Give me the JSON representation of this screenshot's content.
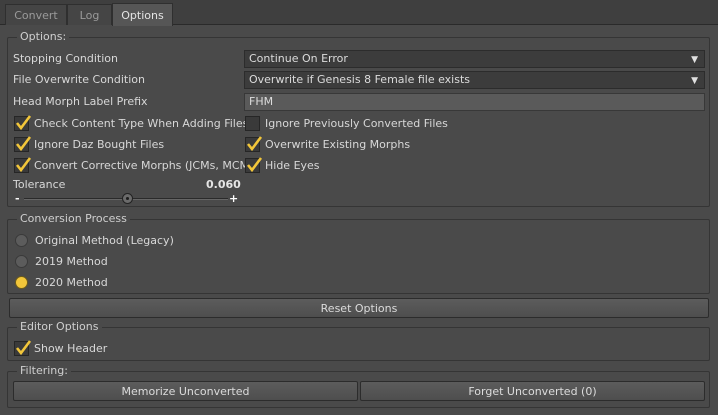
{
  "tabs": [
    {
      "label": "Convert"
    },
    {
      "label": "Log"
    },
    {
      "label": "Options"
    }
  ],
  "options": {
    "group_title": "Options:",
    "stopping_condition": {
      "label": "Stopping Condition",
      "value": "Continue On Error"
    },
    "file_overwrite": {
      "label": "File Overwrite Condition",
      "value": "Overwrite if Genesis 8 Female file exists"
    },
    "head_morph_prefix": {
      "label": "Head Morph Label Prefix",
      "value": "FHM"
    },
    "checkboxes_left": [
      {
        "label": "Check Content Type When Adding Files",
        "checked": true
      },
      {
        "label": "Ignore Daz Bought Files",
        "checked": true
      },
      {
        "label": "Convert Corrective Morphs (JCMs, MCMs)",
        "checked": true
      }
    ],
    "checkboxes_right": [
      {
        "label": "Ignore Previously Converted Files",
        "checked": false
      },
      {
        "label": "Overwrite Existing Morphs",
        "checked": true
      },
      {
        "label": "Hide Eyes",
        "checked": true
      }
    ],
    "tolerance": {
      "label": "Tolerance",
      "value": "0.060",
      "minus": "-",
      "plus": "+",
      "fraction": 0.5
    }
  },
  "conversion": {
    "group_title": "Conversion Process",
    "methods": [
      {
        "label": "Original Method (Legacy)",
        "selected": false
      },
      {
        "label": "2019 Method",
        "selected": false
      },
      {
        "label": "2020 Method",
        "selected": true
      }
    ]
  },
  "reset_button": "Reset Options",
  "editor": {
    "group_title": "Editor Options",
    "show_header": {
      "label": "Show Header",
      "checked": true
    }
  },
  "filtering": {
    "group_title": "Filtering:",
    "memorize_button": "Memorize Unconverted",
    "forget_button": "Forget Unconverted (0)"
  },
  "colors": {
    "accent": "#f2c63a",
    "background": "#4a4a4a"
  }
}
